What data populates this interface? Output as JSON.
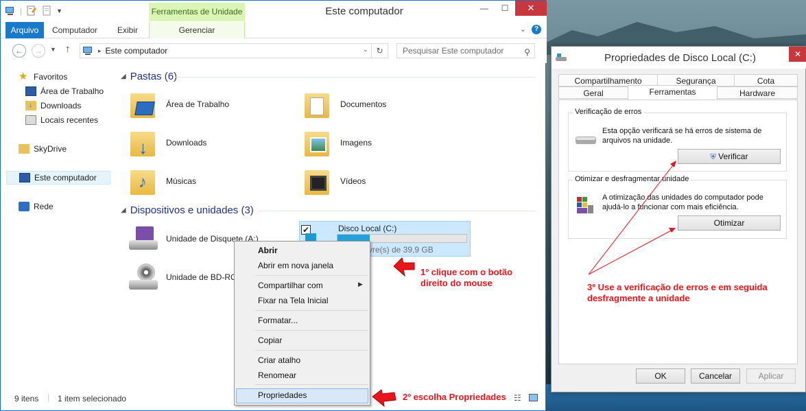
{
  "explorer": {
    "title": "Este computador",
    "context_tab_header": "Ferramentas de Unidade",
    "ribbon_tabs": [
      "Arquivo",
      "Computador",
      "Exibir",
      "Gerenciar"
    ],
    "address": "Este computador",
    "search_placeholder": "Pesquisar Este computador",
    "nav": {
      "favorites": "Favoritos",
      "desktop": "Área de Trabalho",
      "downloads": "Downloads",
      "recent": "Locais recentes",
      "skydrive": "SkyDrive",
      "this_pc": "Este computador",
      "network": "Rede"
    },
    "folders_group": "Pastas (6)",
    "folders": [
      "Área de Trabalho",
      "Documentos",
      "Downloads",
      "Imagens",
      "Músicas",
      "Vídeos"
    ],
    "devices_group": "Dispositivos e unidades (3)",
    "devices": {
      "floppy": "Unidade de Disquete (A:)",
      "local_disk": "Disco Local (C:)",
      "local_disk_free": "vre(s) de 39,9 GB",
      "local_disk_used_fraction": 0.25,
      "bd": "Unidade de BD-ROM"
    },
    "status": {
      "items": "9 itens",
      "selected": "1 item selecionado"
    }
  },
  "context_menu": {
    "items": [
      "Abrir",
      "Abrir em nova janela",
      "Compartilhar com",
      "Fixar na Tela Inicial",
      "Formatar...",
      "Copiar",
      "Criar atalho",
      "Renomear",
      "Propriedades"
    ]
  },
  "dialog": {
    "title": "Propriedades de Disco Local (C:)",
    "tabs_row1": [
      "Compartilhamento",
      "Segurança",
      "Cota"
    ],
    "tabs_row2": [
      "Geral",
      "Ferramentas",
      "Hardware"
    ],
    "error_check": {
      "legend": "Verificação de erros",
      "text": "Esta opção verificará se há erros de sistema de arquivos na unidade.",
      "button": "Verificar"
    },
    "optimize": {
      "legend": "Otimizar e desfragmentar unidade",
      "text": "A otimização das unidades do computador pode ajudá-lo a funcionar com mais eficiência.",
      "button": "Otimizar"
    },
    "buttons": {
      "ok": "OK",
      "cancel": "Cancelar",
      "apply": "Aplicar"
    }
  },
  "annotations": {
    "step1": "1º clique com o botão direito do mouse",
    "step2": "2º escolha Propriedades",
    "step3": "3º Use a verificação de erros e em seguida desfragmente a unidade"
  },
  "colors": {
    "accent": "#1979ca",
    "annotation": "#e8161c",
    "context_tab": "#dbf5b5",
    "selection": "#cce8ff"
  }
}
